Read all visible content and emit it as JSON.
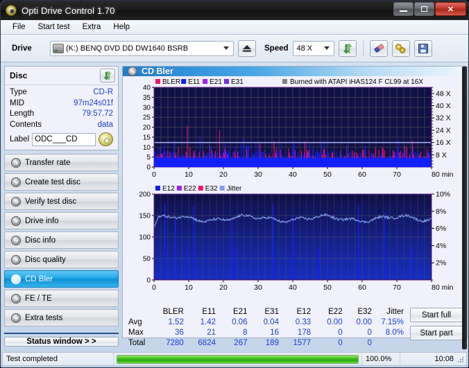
{
  "window": {
    "title": "Opti Drive Control 1.70",
    "icon": "disc-icon",
    "minimize": "–",
    "maximize": "□",
    "close": "x"
  },
  "menu": {
    "items": [
      {
        "label": "File"
      },
      {
        "label": "Start test"
      },
      {
        "label": "Extra"
      },
      {
        "label": "Help"
      }
    ]
  },
  "toolbar": {
    "drive_label": "Drive",
    "drive_value": "(K:)  BENQ DVD DD DW1640 BSRB",
    "eject_icon": "eject-icon",
    "speed_label": "Speed",
    "speed_value": "48 X",
    "refresh_icon": "refresh-icon",
    "erase_icon": "eraser-icon",
    "tools_icon": "tools-icon",
    "save_icon": "save-icon"
  },
  "disc": {
    "title": "Disc",
    "refresh_icon": "refresh-icon",
    "rows": [
      {
        "key": "Type",
        "value": "CD-R"
      },
      {
        "key": "MID",
        "value": "97m24s01f"
      },
      {
        "key": "Length",
        "value": "79:57.72"
      },
      {
        "key": "Contents",
        "value": "data"
      }
    ],
    "label_key": "Label",
    "label_value": "ODC___CD",
    "label_icon": "cd-icon"
  },
  "nav": {
    "items": [
      {
        "label": "Transfer rate",
        "icon": "disc-icon",
        "active": false
      },
      {
        "label": "Create test disc",
        "icon": "disc-icon",
        "active": false
      },
      {
        "label": "Verify test disc",
        "icon": "disc-icon",
        "active": false
      },
      {
        "label": "Drive info",
        "icon": "disc-icon",
        "active": false
      },
      {
        "label": "Disc info",
        "icon": "disc-icon",
        "active": false
      },
      {
        "label": "Disc quality",
        "icon": "disc-icon",
        "active": false
      },
      {
        "label": "CD Bler",
        "icon": "disc-icon",
        "active": true
      },
      {
        "label": "FE / TE",
        "icon": "disc-icon",
        "active": false
      },
      {
        "label": "Extra tests",
        "icon": "disc-icon",
        "active": false
      }
    ],
    "status_window": "Status window > >"
  },
  "main": {
    "title": "CD Bler",
    "title_icon": "disc-icon",
    "burn_note": "Burned with ATAPI iHAS124   F CL99 at 16X",
    "burn_note_color": "#808080"
  },
  "chart_data": [
    {
      "type": "line",
      "name": "bler-chart",
      "title": "CD Bler",
      "xlabel": "min",
      "ylabel": "",
      "xlim": [
        0,
        80
      ],
      "ylim": [
        0,
        40
      ],
      "xticks": [
        0,
        10,
        20,
        30,
        40,
        50,
        60,
        70,
        80
      ],
      "xtick_labels": [
        "0",
        "10",
        "20",
        "30",
        "40",
        "50",
        "60",
        "70",
        "80 min"
      ],
      "yticks": [
        0,
        5,
        10,
        15,
        20,
        25,
        30,
        35,
        40
      ],
      "y2label": "X",
      "y2ticks": [
        8,
        16,
        24,
        32,
        40,
        48
      ],
      "y2tick_labels": [
        "8 X",
        "16 X",
        "24 X",
        "32 X",
        "40 X",
        "48 X"
      ],
      "y2lim": [
        0,
        52
      ],
      "grid": true,
      "background": "#101048",
      "legend_position": "top-left",
      "legend": [
        {
          "name": "BLER",
          "color": "#ff1070"
        },
        {
          "name": "E11",
          "color": "#1020ff"
        },
        {
          "name": "E21",
          "color": "#a020f0"
        },
        {
          "name": "E31",
          "color": "#7030e0"
        }
      ],
      "series": [
        {
          "name": "BLER",
          "color": "#ff1070",
          "avg": 1.52,
          "max": 36,
          "total": 7280
        },
        {
          "name": "E11",
          "color": "#1020ff",
          "avg": 1.42,
          "max": 21,
          "total": 6824
        },
        {
          "name": "E21",
          "color": "#a020f0",
          "avg": 0.06,
          "max": 8,
          "total": 267
        },
        {
          "name": "E31",
          "color": "#7030e0",
          "avg": 0.04,
          "max": 16,
          "total": 189
        }
      ],
      "speed_curve": {
        "name": "read speed",
        "color": "#aab8ff",
        "value_x": 16
      }
    },
    {
      "type": "line",
      "name": "jitter-chart",
      "xlabel": "min",
      "xlim": [
        0,
        80
      ],
      "ylim": [
        0,
        200
      ],
      "xticks": [
        0,
        10,
        20,
        30,
        40,
        50,
        60,
        70,
        80
      ],
      "xtick_labels": [
        "0",
        "10",
        "20",
        "30",
        "40",
        "50",
        "60",
        "70",
        "80 min"
      ],
      "yticks": [
        0,
        50,
        100,
        150,
        200
      ],
      "y2lim": [
        0,
        10
      ],
      "y2ticks": [
        2,
        4,
        6,
        8,
        10
      ],
      "y2tick_labels": [
        "2%",
        "4%",
        "6%",
        "8%",
        "10%"
      ],
      "grid": true,
      "background": "#101048",
      "legend_position": "top-left",
      "legend": [
        {
          "name": "E12",
          "color": "#1020ff"
        },
        {
          "name": "E22",
          "color": "#a020f0"
        },
        {
          "name": "E32",
          "color": "#ff1070"
        },
        {
          "name": "Jitter",
          "color": "#7e9ce8"
        }
      ],
      "series": [
        {
          "name": "E12",
          "color": "#1020ff",
          "avg": 0.33,
          "max": 178,
          "total": 1577
        },
        {
          "name": "E22",
          "color": "#a020f0",
          "avg": 0.0,
          "max": 0,
          "total": 0
        },
        {
          "name": "E32",
          "color": "#ff1070",
          "avg": 0.0,
          "max": 0,
          "total": 0
        },
        {
          "name": "Jitter",
          "color": "#7e9ce8",
          "avg": "7.15%",
          "max": "8.0%",
          "total": ""
        }
      ]
    }
  ],
  "stats": {
    "columns": [
      "BLER",
      "E11",
      "E21",
      "E31",
      "E12",
      "E22",
      "E32",
      "Jitter"
    ],
    "rows": [
      {
        "label": "Avg",
        "values": [
          "1.52",
          "1.42",
          "0.06",
          "0.04",
          "0.33",
          "0.00",
          "0.00",
          "7.15%"
        ]
      },
      {
        "label": "Max",
        "values": [
          "36",
          "21",
          "8",
          "16",
          "178",
          "0",
          "0",
          "8.0%"
        ]
      },
      {
        "label": "Total",
        "values": [
          "7280",
          "6824",
          "267",
          "189",
          "1577",
          "0",
          "0",
          ""
        ]
      }
    ],
    "start_full": "Start full",
    "start_part": "Start part"
  },
  "statusbar": {
    "message": "Test completed",
    "percent_label": "100.0%",
    "percent_value": 100,
    "time": "10:08"
  }
}
